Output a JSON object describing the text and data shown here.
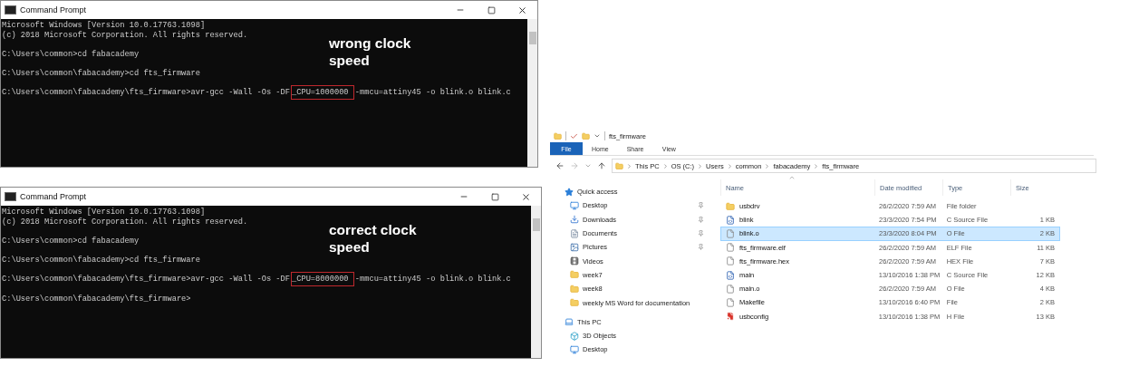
{
  "terminals": [
    {
      "title": "Command Prompt",
      "annotation": "wrong clock speed",
      "blocks": [
        [
          {
            "segments": [
              {
                "text": "Microsoft Windows [Version 10.0.17763.1098]",
                "boxed": false
              }
            ]
          },
          {
            "segments": [
              {
                "text": "(c) 2018 Microsoft Corporation. All rights reserved.",
                "boxed": false
              }
            ]
          }
        ],
        [
          {
            "segments": [
              {
                "text": "C:\\Users\\common>cd fabacademy",
                "boxed": false
              }
            ]
          }
        ],
        [
          {
            "segments": [
              {
                "text": "C:\\Users\\common\\fabacademy>cd fts_firmware",
                "boxed": false
              }
            ]
          }
        ],
        [
          {
            "segments": [
              {
                "text": "C:\\Users\\common\\fabacademy\\fts_firmware>avr-gcc -Wall -Os -DF",
                "boxed": false
              },
              {
                "text": "_CPU=1000000 ",
                "boxed": true
              },
              {
                "text": "-mmcu=attiny45 -o blink.o blink.c",
                "boxed": false
              }
            ]
          }
        ]
      ]
    },
    {
      "title": "Command Prompt",
      "annotation": "correct clock speed",
      "blocks": [
        [
          {
            "segments": [
              {
                "text": "Microsoft Windows [Version 10.0.17763.1098]",
                "boxed": false
              }
            ]
          },
          {
            "segments": [
              {
                "text": "(c) 2018 Microsoft Corporation. All rights reserved.",
                "boxed": false
              }
            ]
          }
        ],
        [
          {
            "segments": [
              {
                "text": "C:\\Users\\common>cd fabacademy",
                "boxed": false
              }
            ]
          }
        ],
        [
          {
            "segments": [
              {
                "text": "C:\\Users\\common\\fabacademy>cd fts_firmware",
                "boxed": false
              }
            ]
          }
        ],
        [
          {
            "segments": [
              {
                "text": "C:\\Users\\common\\fabacademy\\fts_firmware>avr-gcc -Wall -Os -DF",
                "boxed": false
              },
              {
                "text": "_CPU=8000000 ",
                "boxed": true
              },
              {
                "text": "-mmcu=attiny45 -o blink.o blink.c",
                "boxed": false
              }
            ]
          }
        ],
        [
          {
            "segments": [
              {
                "text": "C:\\Users\\common\\fabacademy\\fts_firmware>",
                "boxed": false
              }
            ]
          }
        ]
      ]
    }
  ],
  "explorer": {
    "title": "fts_firmware",
    "ribbon_tabs": [
      {
        "label": "File",
        "selected": true
      },
      {
        "label": "Home",
        "selected": false
      },
      {
        "label": "Share",
        "selected": false
      },
      {
        "label": "View",
        "selected": false
      }
    ],
    "breadcrumb": [
      "This PC",
      "OS (C:)",
      "Users",
      "common",
      "fabacademy",
      "fts_firmware"
    ],
    "nav": [
      {
        "label": "Quick access",
        "kind": "star",
        "children": [
          {
            "label": "Desktop",
            "kind": "desktop",
            "pinned": true
          },
          {
            "label": "Downloads",
            "kind": "download",
            "pinned": true
          },
          {
            "label": "Documents",
            "kind": "document",
            "pinned": true
          },
          {
            "label": "Pictures",
            "kind": "picture",
            "pinned": true
          },
          {
            "label": "Videos",
            "kind": "video",
            "pinned": false
          },
          {
            "label": "week7",
            "kind": "folder",
            "pinned": false
          },
          {
            "label": "week8",
            "kind": "folder",
            "pinned": false
          },
          {
            "label": "weekly MS Word for documentation",
            "kind": "folder",
            "pinned": false
          }
        ]
      },
      {
        "label": "This PC",
        "kind": "pc",
        "children": [
          {
            "label": "3D Objects",
            "kind": "cube",
            "pinned": false
          },
          {
            "label": "Desktop",
            "kind": "desktop",
            "pinned": false
          }
        ]
      }
    ],
    "columns": [
      "Name",
      "Date modified",
      "Type",
      "Size"
    ],
    "files": [
      {
        "name": "usbdrv",
        "date": "26/2/2020 7:59 AM",
        "type": "File folder",
        "kind": "folder",
        "selected": false
      },
      {
        "name": "blink",
        "date": "23/3/2020 7:54 PM",
        "type": "C Source File",
        "size": "1 KB",
        "kind": "c",
        "selected": false
      },
      {
        "name": "blink.o",
        "date": "23/3/2020 8:04 PM",
        "type": "O File",
        "size": "2 KB",
        "kind": "file",
        "selected": true
      },
      {
        "name": "fts_firmware.elf",
        "date": "26/2/2020 7:59 AM",
        "type": "ELF File",
        "size": "11 KB",
        "kind": "file",
        "selected": false
      },
      {
        "name": "fts_firmware.hex",
        "date": "26/2/2020 7:59 AM",
        "type": "HEX File",
        "size": "7 KB",
        "kind": "file",
        "selected": false
      },
      {
        "name": "main",
        "date": "13/10/2016 1:38 PM",
        "type": "C Source File",
        "size": "12 KB",
        "kind": "c",
        "selected": false
      },
      {
        "name": "main.o",
        "date": "26/2/2020 7:59 AM",
        "type": "O File",
        "size": "4 KB",
        "kind": "file",
        "selected": false
      },
      {
        "name": "Makefile",
        "date": "13/10/2016 6:40 PM",
        "type": "File",
        "size": "2 KB",
        "kind": "file",
        "selected": false
      },
      {
        "name": "usbconfig",
        "date": "13/10/2016 1:38 PM",
        "type": "H File",
        "size": "13 KB",
        "kind": "config",
        "selected": false
      }
    ]
  }
}
